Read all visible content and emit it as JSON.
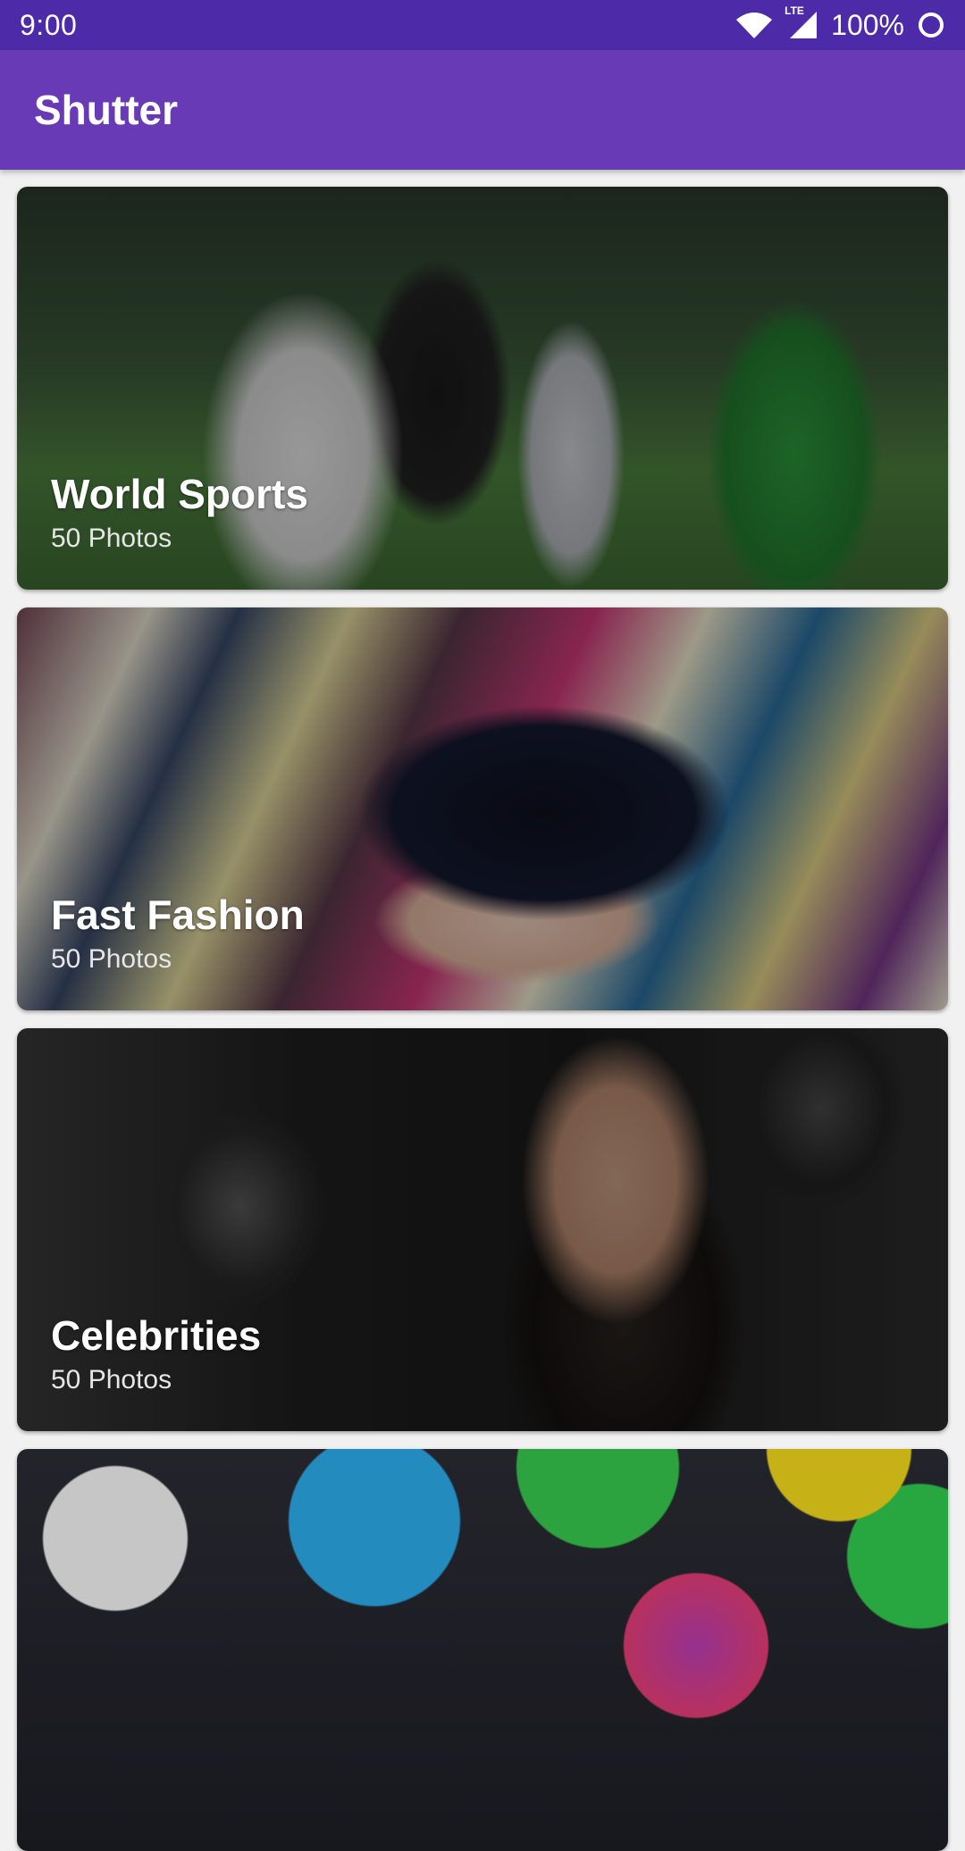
{
  "status_bar": {
    "time": "9:00",
    "battery": "100%",
    "icons": [
      "wifi-icon",
      "lte-signal-icon",
      "battery-icon"
    ],
    "network_label": "LTE"
  },
  "app_bar": {
    "title": "Shutter",
    "color": "#683ab6"
  },
  "categories": [
    {
      "title": "World Sports",
      "count": "50 Photos"
    },
    {
      "title": "Fast Fashion",
      "count": "50 Photos"
    },
    {
      "title": "Celebrities",
      "count": "50 Photos"
    },
    {
      "title": "",
      "count": ""
    }
  ],
  "colors": {
    "status_bar": "#4d2aa8",
    "app_bar": "#683ab6",
    "background": "#f1f1f1"
  }
}
